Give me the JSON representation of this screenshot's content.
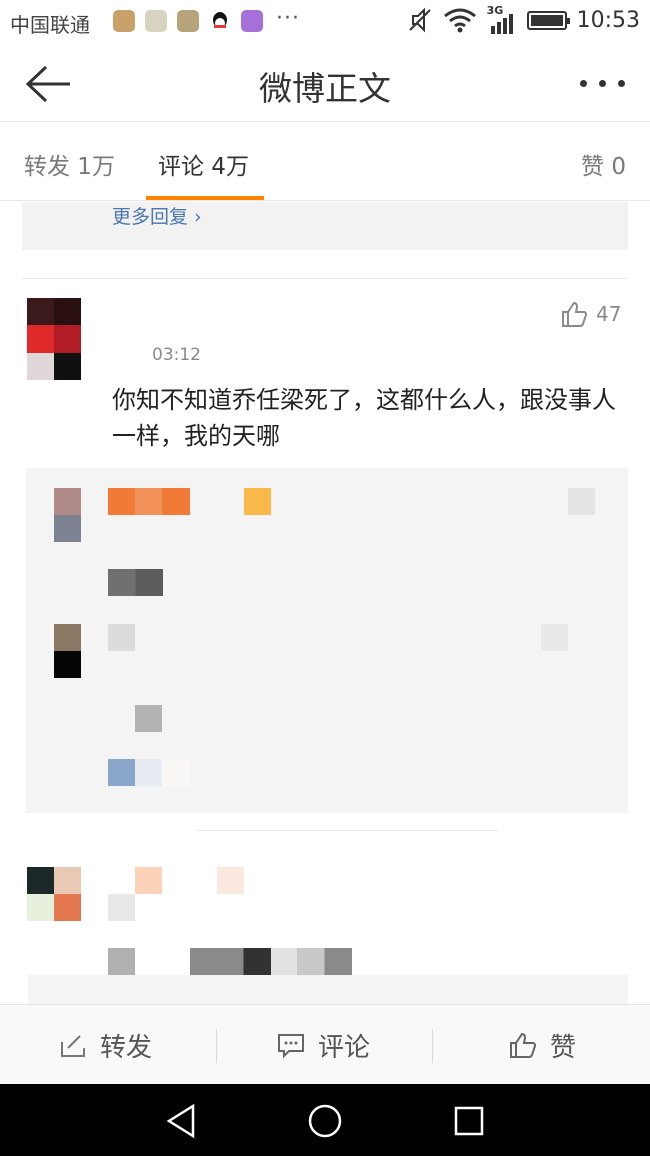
{
  "status_bar": {
    "carrier": "中国联通",
    "more": "···",
    "network": "3G",
    "time": "10:53",
    "icons": [
      "health-app-icon",
      "gallery-app-icon",
      "photo-app-icon",
      "qq-icon",
      "keyboard-app-icon"
    ]
  },
  "header": {
    "title": "微博正文",
    "back_icon": "arrow-left-icon",
    "more_icon": "more-dots-icon"
  },
  "tabs": [
    {
      "label": "转发 1万",
      "active": false
    },
    {
      "label": "评论 4万",
      "active": true
    },
    {
      "label": "赞 0",
      "active": false
    }
  ],
  "thread_top": {
    "more_replies": "更多回复 ›"
  },
  "comment": {
    "time": "03:12",
    "likes": "47",
    "text": "你知不知道乔任梁死了，这都什么人，跟没事人一样，我的天哪"
  },
  "action_bar": {
    "repost": "转发",
    "comment": "评论",
    "like": "赞"
  },
  "colors": {
    "accent": "#ff8200",
    "link": "#4a77b0",
    "nav_bg": "#000000"
  }
}
